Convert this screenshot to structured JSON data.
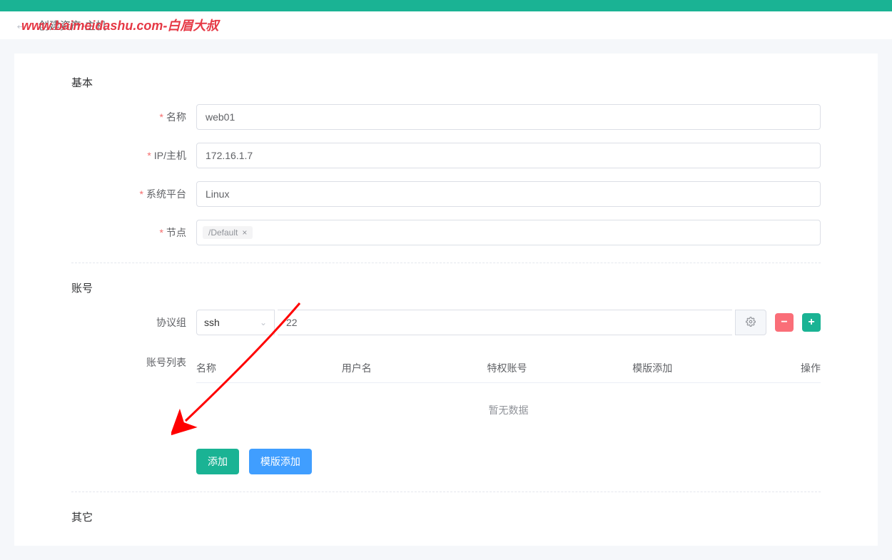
{
  "watermark": "www.baimeidashu.com-白眉大叔",
  "header": {
    "title": "创建资产-主机"
  },
  "sections": {
    "basic": {
      "title": "基本",
      "fields": {
        "name": {
          "label": "名称",
          "value": "web01"
        },
        "ip": {
          "label": "IP/主机",
          "value": "172.16.1.7"
        },
        "platform": {
          "label": "系统平台",
          "value": "Linux"
        },
        "node": {
          "label": "节点",
          "tags": [
            "/Default"
          ]
        }
      }
    },
    "account": {
      "title": "账号",
      "protocol_group": {
        "label": "协议组",
        "protocol": "ssh",
        "port": "22"
      },
      "account_list": {
        "label": "账号列表",
        "columns": {
          "name": "名称",
          "user": "用户名",
          "priv": "特权账号",
          "tmpl": "模版添加",
          "action": "操作"
        },
        "empty": "暂无数据",
        "buttons": {
          "add": "添加",
          "tmpl_add": "模版添加"
        }
      }
    },
    "other": {
      "title": "其它"
    }
  }
}
